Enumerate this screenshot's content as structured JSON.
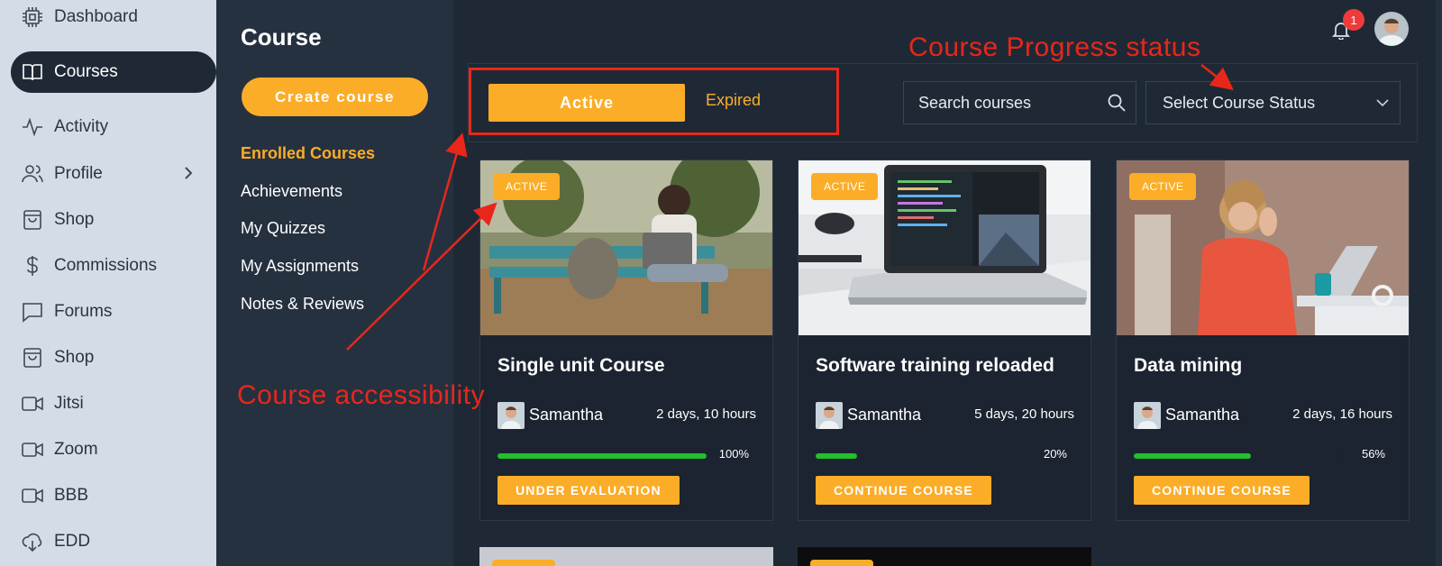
{
  "sidebar": {
    "items": [
      {
        "label": "Dashboard",
        "icon": "chip-icon"
      },
      {
        "label": "Courses",
        "icon": "book-icon",
        "active": true
      },
      {
        "label": "Activity",
        "icon": "activity-icon"
      },
      {
        "label": "Profile",
        "icon": "users-icon",
        "has_submenu": true
      },
      {
        "label": "Shop",
        "icon": "shopping-bag-icon"
      },
      {
        "label": "Commissions",
        "icon": "dollar-icon"
      },
      {
        "label": "Forums",
        "icon": "chat-icon"
      },
      {
        "label": "Shop",
        "icon": "shopping-bag-icon"
      },
      {
        "label": "Jitsi",
        "icon": "video-icon"
      },
      {
        "label": "Zoom",
        "icon": "video-icon"
      },
      {
        "label": "BBB",
        "icon": "video-icon"
      },
      {
        "label": "EDD",
        "icon": "cloud-download-icon"
      }
    ]
  },
  "course_menu": {
    "title": "Course",
    "create_label": "Create course",
    "items": [
      {
        "label": "Enrolled Courses",
        "active": true
      },
      {
        "label": "Achievements"
      },
      {
        "label": "My Quizzes"
      },
      {
        "label": "My Assignments"
      },
      {
        "label": "Notes & Reviews"
      }
    ]
  },
  "filters": {
    "tabs": [
      {
        "label": "Active",
        "selected": true
      },
      {
        "label": "Expired"
      }
    ],
    "search_placeholder": "Search courses",
    "status_select": "Select Course Status"
  },
  "header": {
    "notification_count": "1"
  },
  "courses": [
    {
      "badge": "ACTIVE",
      "title": "Single unit Course",
      "author": "Samantha",
      "duration": "2 days, 10 hours",
      "progress": 100,
      "progress_label": "100%",
      "action": "UNDER EVALUATION"
    },
    {
      "badge": "ACTIVE",
      "title": "Software training reloaded",
      "author": "Samantha",
      "duration": "5 days, 20 hours",
      "progress": 20,
      "progress_label": "20%",
      "action": "CONTINUE COURSE"
    },
    {
      "badge": "ACTIVE",
      "title": "Data mining",
      "author": "Samantha",
      "duration": "2 days, 16 hours",
      "progress": 56,
      "progress_label": "56%",
      "action": "CONTINUE COURSE"
    }
  ],
  "annotations": {
    "progress_status": "Course Progress status",
    "accessibility": "Course accessibility"
  },
  "colors": {
    "accent": "#fbad28",
    "progress": "#22c02c",
    "annotation": "#e8271b",
    "badge_alert": "#ef3b3b"
  }
}
